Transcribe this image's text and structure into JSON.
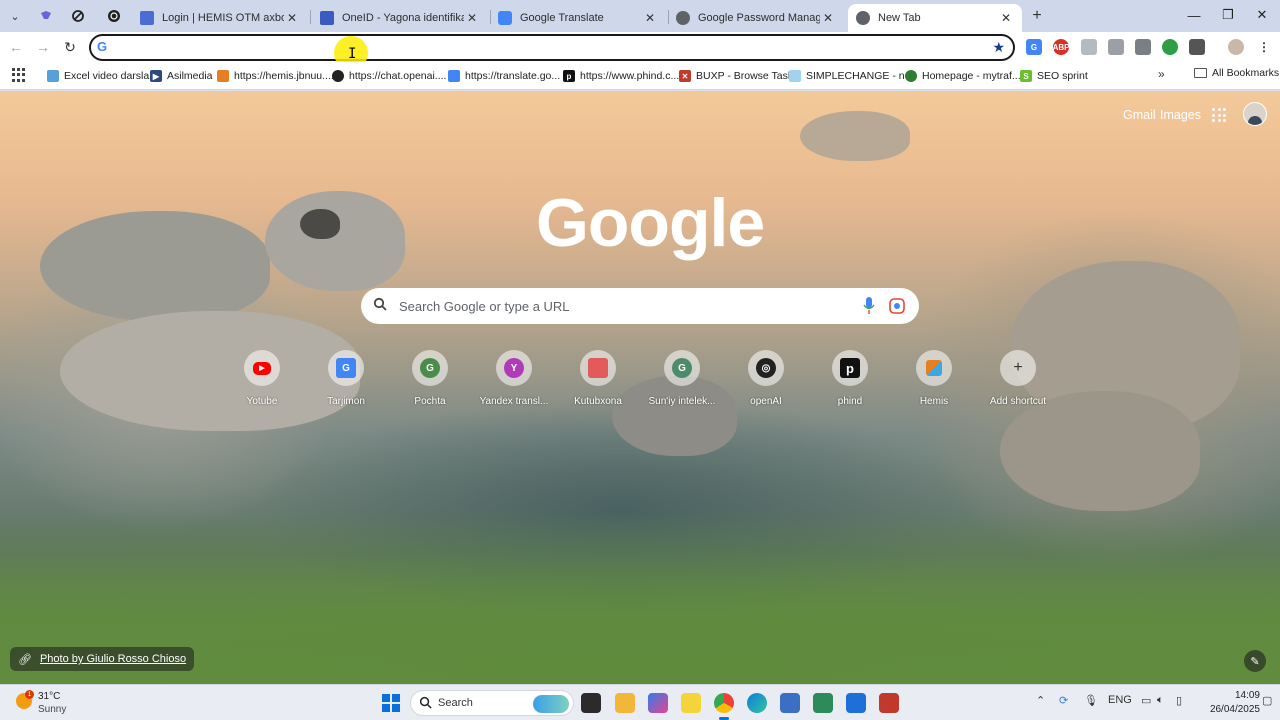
{
  "tabs": {
    "items": [
      {
        "title": "Login | HEMIS OTM axborot tizimi",
        "color": "#4a6cd4"
      },
      {
        "title": "OneID - Yagona identifikatsiya",
        "color": "#3a5bbf"
      },
      {
        "title": "Google Translate",
        "color": "#4285f4"
      },
      {
        "title": "Google Password Manager",
        "color": "#5f6368"
      },
      {
        "title": "New Tab",
        "color": "#5f6368"
      }
    ],
    "close_glyph": "✕",
    "new_tab_glyph": "+"
  },
  "toolbar": {
    "back_glyph": "←",
    "forward_glyph": "→",
    "reload_glyph": "↻",
    "omnibox_value": "",
    "omnibox_icon": "G",
    "star_glyph": "★"
  },
  "window": {
    "minimize": "—",
    "maximize": "❐",
    "close": "✕"
  },
  "bookmarks": {
    "items": [
      {
        "label": "Excel video darslar",
        "icon": "image-icon",
        "color": "#5aa0d8"
      },
      {
        "label": "Asilmedia",
        "icon": "play-icon",
        "color": "#2d4a7a"
      },
      {
        "label": "https://hemis.jbnuu....",
        "icon": "hemis-icon",
        "color": "#e67e22"
      },
      {
        "label": "https://chat.openai....",
        "icon": "openai-icon",
        "color": "#222222"
      },
      {
        "label": "https://translate.go...",
        "icon": "translate-icon",
        "color": "#4285f4"
      },
      {
        "label": "https://www.phind.c...",
        "icon": "phind-icon",
        "color": "#111111"
      },
      {
        "label": "BUXP - Browse Tasks",
        "icon": "buxp-icon",
        "color": "#c0392b"
      },
      {
        "label": "SIMPLECHANGE - n...",
        "icon": "simplechange-icon",
        "color": "#9fd3ef"
      },
      {
        "label": "Homepage - mytraf...",
        "icon": "globe-icon",
        "color": "#2f7d32"
      },
      {
        "label": "SEO sprint",
        "icon": "seo-icon",
        "color": "#6abf2e"
      }
    ],
    "more_glyph": "»",
    "all_label": "All Bookmarks"
  },
  "ntp": {
    "gmail": "Gmail",
    "images": "Images",
    "logo": "Google",
    "search_placeholder": "Search Google or type a URL",
    "shortcuts": [
      {
        "label": "Yotube",
        "glyph": "▶",
        "color": "#ff0000"
      },
      {
        "label": "Tarjimon",
        "glyph": "G",
        "color": "#4285f4"
      },
      {
        "label": "Pochta",
        "glyph": "G",
        "color": "#4c8c4a"
      },
      {
        "label": "Yandex transl...",
        "glyph": "Y",
        "color": "#b03ab8"
      },
      {
        "label": "Kutubxona",
        "glyph": "",
        "color": "#e25a5a"
      },
      {
        "label": "Sun'iy intelek...",
        "glyph": "G",
        "color": "#4c8c6a"
      },
      {
        "label": "openAI",
        "glyph": "◎",
        "color": "#222222"
      },
      {
        "label": "phind",
        "glyph": "p",
        "color": "#111111"
      },
      {
        "label": "Hemis",
        "glyph": "",
        "color": "#e67e22"
      },
      {
        "label": "Add shortcut",
        "glyph": "+",
        "color": "#ffffff"
      }
    ],
    "photo_credit": "Photo by Giulio Rosso Chioso"
  },
  "taskbar": {
    "temperature": "31°C",
    "weather": "Sunny",
    "weather_badge": "1",
    "search_label": "Search",
    "language": "ENG",
    "time": "14:09",
    "date": "26/04/2025"
  }
}
